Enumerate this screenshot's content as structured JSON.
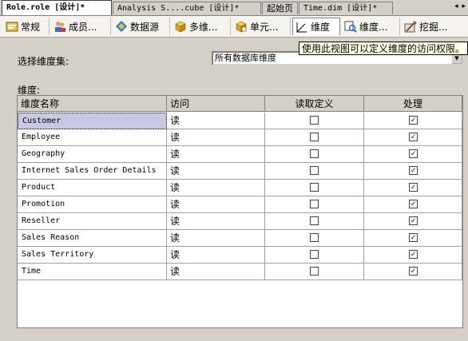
{
  "doc_tabs": [
    {
      "label": "Role.role [设计]*",
      "active": true
    },
    {
      "label": "Analysis S....cube [设计]*",
      "active": false
    },
    {
      "label": "起始页",
      "active": false
    },
    {
      "label": "Time.dim [设计]*",
      "active": false
    }
  ],
  "tab_scroll_label": "◂ ▸",
  "toolbar": {
    "tabs": [
      {
        "label": "常规",
        "icon": "general-icon"
      },
      {
        "label": "成员...",
        "icon": "members-icon"
      },
      {
        "label": "数据源",
        "icon": "datasource-icon"
      },
      {
        "label": "多维...",
        "icon": "cube-icon"
      },
      {
        "label": "单元...",
        "icon": "cell-icon"
      },
      {
        "label": "维度",
        "icon": "dimension-icon",
        "selected": true
      },
      {
        "label": "维度...",
        "icon": "dimension-data-icon"
      },
      {
        "label": "挖掘...",
        "icon": "mining-icon"
      }
    ],
    "tooltip": "使用此视图可以定义维度的访问权限。"
  },
  "dimension_set": {
    "label": "选择维度集:",
    "value": "所有数据库维度"
  },
  "dimensions_label": "维度:",
  "grid": {
    "columns": [
      "维度名称",
      "访问",
      "读取定义",
      "处理"
    ],
    "rows": [
      {
        "name": "Customer",
        "access": "读",
        "read_definition": false,
        "process": true
      },
      {
        "name": "Employee",
        "access": "读",
        "read_definition": false,
        "process": true
      },
      {
        "name": "Geography",
        "access": "读",
        "read_definition": false,
        "process": true
      },
      {
        "name": "Internet Sales Order Details",
        "access": "读",
        "read_definition": false,
        "process": true
      },
      {
        "name": "Product",
        "access": "读",
        "read_definition": false,
        "process": true
      },
      {
        "name": "Promotion",
        "access": "读",
        "read_definition": false,
        "process": true
      },
      {
        "name": "Reseller",
        "access": "读",
        "read_definition": false,
        "process": true
      },
      {
        "name": "Sales Reason",
        "access": "读",
        "read_definition": false,
        "process": true
      },
      {
        "name": "Sales Territory",
        "access": "读",
        "read_definition": false,
        "process": true
      },
      {
        "name": "Time",
        "access": "读",
        "read_definition": false,
        "process": true
      }
    ]
  },
  "colors": {
    "chrome": "#d4d0c8",
    "toolbar": "#f4f3ee",
    "selected_cell": "#c8c8e6",
    "tooltip": "#ffffe1"
  }
}
